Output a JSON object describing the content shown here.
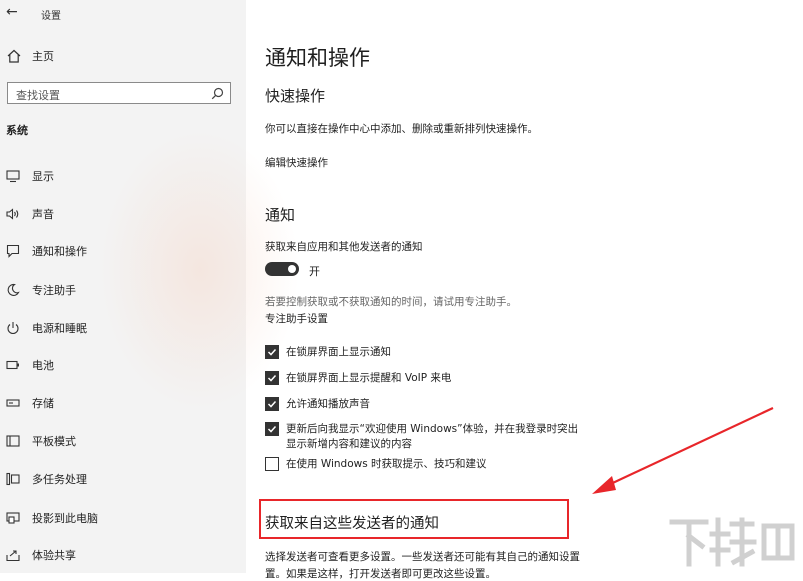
{
  "window": {
    "title": "设置"
  },
  "sidebar": {
    "home_label": "主页",
    "search_placeholder": "查找设置",
    "section_label": "系统",
    "items": [
      {
        "label": "显示",
        "icon": "monitor-icon"
      },
      {
        "label": "声音",
        "icon": "speaker-icon"
      },
      {
        "label": "通知和操作",
        "icon": "notification-icon"
      },
      {
        "label": "专注助手",
        "icon": "moon-icon"
      },
      {
        "label": "电源和睡眠",
        "icon": "power-icon"
      },
      {
        "label": "电池",
        "icon": "battery-icon"
      },
      {
        "label": "存储",
        "icon": "storage-icon"
      },
      {
        "label": "平板模式",
        "icon": "tablet-icon"
      },
      {
        "label": "多任务处理",
        "icon": "multitask-icon"
      },
      {
        "label": "投影到此电脑",
        "icon": "project-icon"
      },
      {
        "label": "体验共享",
        "icon": "share-icon"
      }
    ]
  },
  "main": {
    "title": "通知和操作",
    "quick": {
      "heading": "快速操作",
      "desc": "你可以直接在操作中心中添加、删除或重新排列快速操作。",
      "link": "编辑快速操作"
    },
    "notify": {
      "heading": "通知",
      "get_label": "获取来自应用和其他发送者的通知",
      "toggle_state": "开",
      "focus_hint": "若要控制获取或不获取通知的时间，请试用专注助手。",
      "focus_link": "专注助手设置",
      "checkboxes": [
        {
          "label": "在锁屏界面上显示通知",
          "checked": true
        },
        {
          "label": "在锁屏界面上显示提醒和 VoIP 来电",
          "checked": true
        },
        {
          "label": "允许通知播放声音",
          "checked": true
        },
        {
          "label": "更新后向我显示“欢迎使用 Windows”体验，并在我登录时突出",
          "label2": "显示新增内容和建议的内容",
          "checked": true
        },
        {
          "label": "在使用 Windows 时获取提示、技巧和建议",
          "checked": false
        }
      ]
    },
    "senders": {
      "heading": "获取来自这些发送者的通知",
      "desc1": "选择发送者可查看更多设置。一些发送者还可能有其自己的通知设置",
      "desc2": "置。如果是这样，打开发送者即可更改这些设置。"
    }
  },
  "annotation": {
    "color": "#e8262a"
  },
  "watermark": {
    "text": "下载吧"
  }
}
